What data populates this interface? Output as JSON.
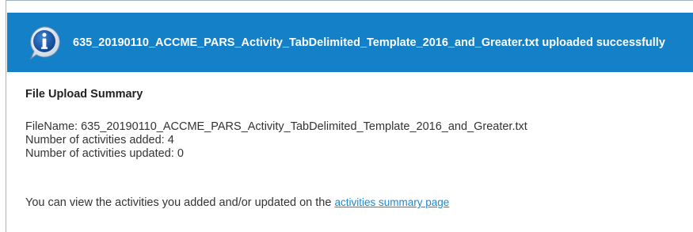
{
  "banner": {
    "message": "635_20190110_ACCME_PARS_Activity_TabDelimited_Template_2016_and_Greater.txt uploaded successfully",
    "icon": "info-icon",
    "background_color": "#1380c8"
  },
  "summary": {
    "title": "File Upload Summary",
    "filename_line": "FileName: 635_20190110_ACCME_PARS_Activity_TabDelimited_Template_2016_and_Greater.txt",
    "added_line": "Number of activities added: 4",
    "updated_line": "Number of activities updated: 0"
  },
  "footer": {
    "text": "You can view the activities you added and/or updated on the ",
    "link_label": "activities summary page"
  }
}
